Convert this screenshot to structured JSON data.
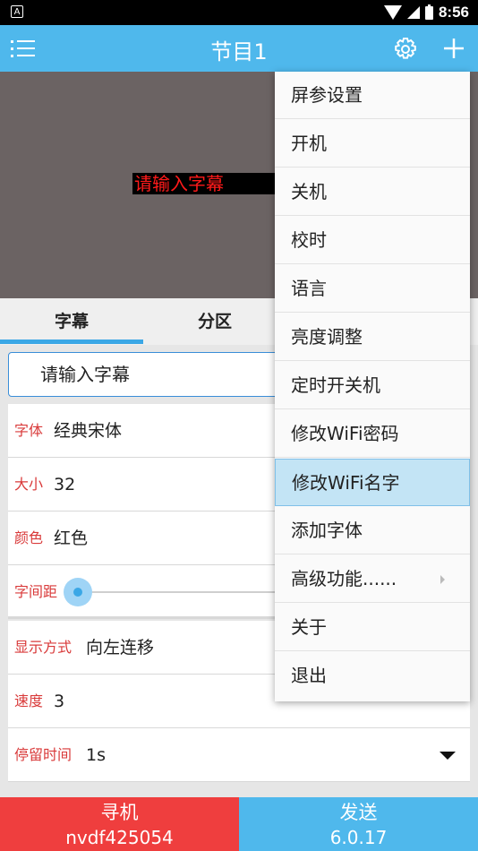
{
  "status_bar": {
    "notification_icon": "A",
    "time": "8:56"
  },
  "app_bar": {
    "title": "节目1",
    "menu_icon": "menu-list-icon",
    "settings_icon": "gear-icon",
    "add_icon": "plus-icon"
  },
  "preview": {
    "caption_text": "请输入字幕",
    "caption_color": "#ff1a1a",
    "background": "#6b6363"
  },
  "tabs": [
    {
      "label": "字幕",
      "active": true
    },
    {
      "label": "分区",
      "active": false
    }
  ],
  "subtitle_input": {
    "value": "请输入字幕"
  },
  "settings_rows": {
    "font": {
      "label": "字体",
      "value": "经典宋体"
    },
    "size": {
      "label": "大小",
      "value": "32"
    },
    "color": {
      "label": "颜色",
      "value": "红色"
    },
    "spacing": {
      "label": "字间距",
      "value_fraction": 0.0
    },
    "display_mode": {
      "label": "显示方式",
      "value": "向左连移"
    },
    "speed": {
      "label": "速度",
      "value": "3"
    },
    "stay_time": {
      "label": "停留时间",
      "value": "1s"
    }
  },
  "bottom_buttons": {
    "find": {
      "label": "寻机",
      "sub": "nvdf425054"
    },
    "send": {
      "label": "发送",
      "sub": "6.0.17"
    }
  },
  "popup_menu": {
    "items": [
      "屏参设置",
      "开机",
      "关机",
      "校时",
      "语言",
      "亮度调整",
      "定时开关机",
      "修改WiFi密码",
      "修改WiFi名字",
      "添加字体",
      "高级功能......",
      "关于",
      "退出"
    ],
    "selected_index": 8
  },
  "colors": {
    "accent": "#4fb8ec",
    "danger": "#ef3e3e",
    "label_red": "#d93a3a"
  }
}
